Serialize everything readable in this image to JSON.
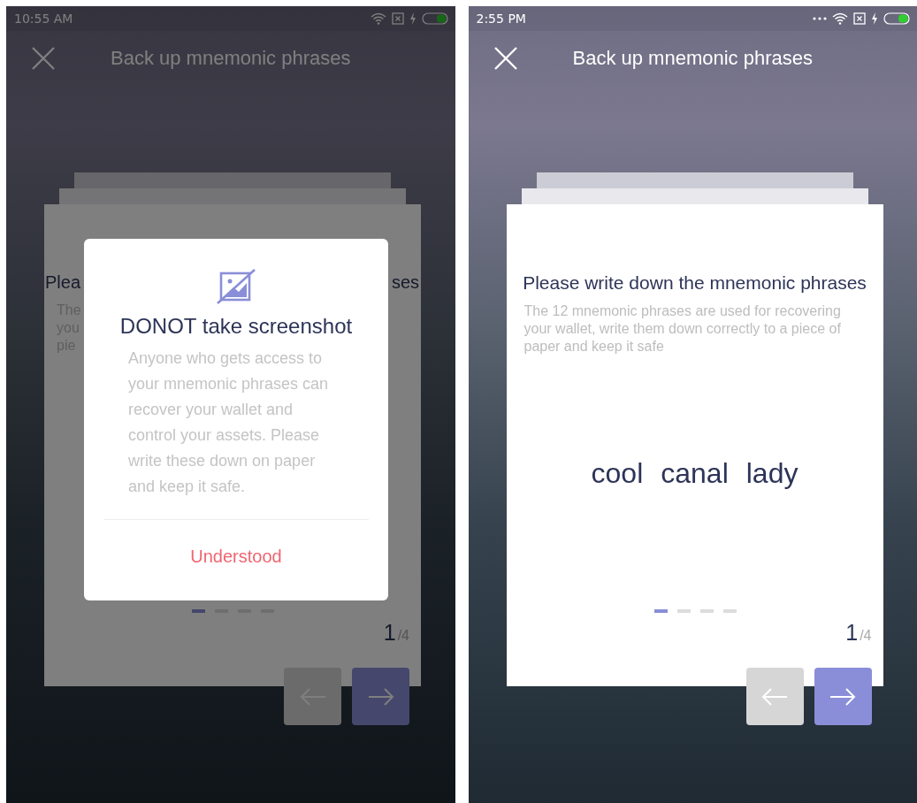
{
  "screens": [
    {
      "status_bar": {
        "time": "10:55 AM",
        "more_notifications": false
      },
      "header": {
        "title": "Back up mnemonic phrases"
      },
      "card": {
        "kind": "covered",
        "title_fragments": [
          "Plea",
          "ses"
        ],
        "description_fragments": [
          "The",
          "you",
          "pie"
        ],
        "dots": [
          {
            "selected": true
          },
          {
            "selected": false
          },
          {
            "selected": false
          },
          {
            "selected": false
          }
        ],
        "page": "1",
        "page_total": "/4"
      },
      "nav_buttons": [
        {
          "kind": "prev",
          "disabled": true
        },
        {
          "kind": "next",
          "disabled": false
        }
      ],
      "dialog": {
        "title": "DONOT take screenshot",
        "body": "Anyone who gets access to your mnemonic phrases can recover your wallet and control your assets. Please write these down on paper and keep it safe.",
        "button": "Understood"
      }
    },
    {
      "status_bar": {
        "time": "2:55 PM",
        "more_notifications": true
      },
      "header": {
        "title": "Back up mnemonic phrases"
      },
      "card": {
        "kind": "full",
        "title": "Please write down the mnemonic phrases",
        "description": "The 12 mnemonic phrases are used for recovering your wallet, write them down correctly to a piece of paper and keep it safe",
        "words": [
          "cool",
          "canal",
          "lady"
        ],
        "dots": [
          {
            "selected": true
          },
          {
            "selected": false
          },
          {
            "selected": false
          },
          {
            "selected": false
          }
        ],
        "page": "1",
        "page_total": "/4"
      },
      "nav_buttons": [
        {
          "kind": "prev",
          "disabled": true
        },
        {
          "kind": "next",
          "disabled": false
        }
      ]
    }
  ]
}
